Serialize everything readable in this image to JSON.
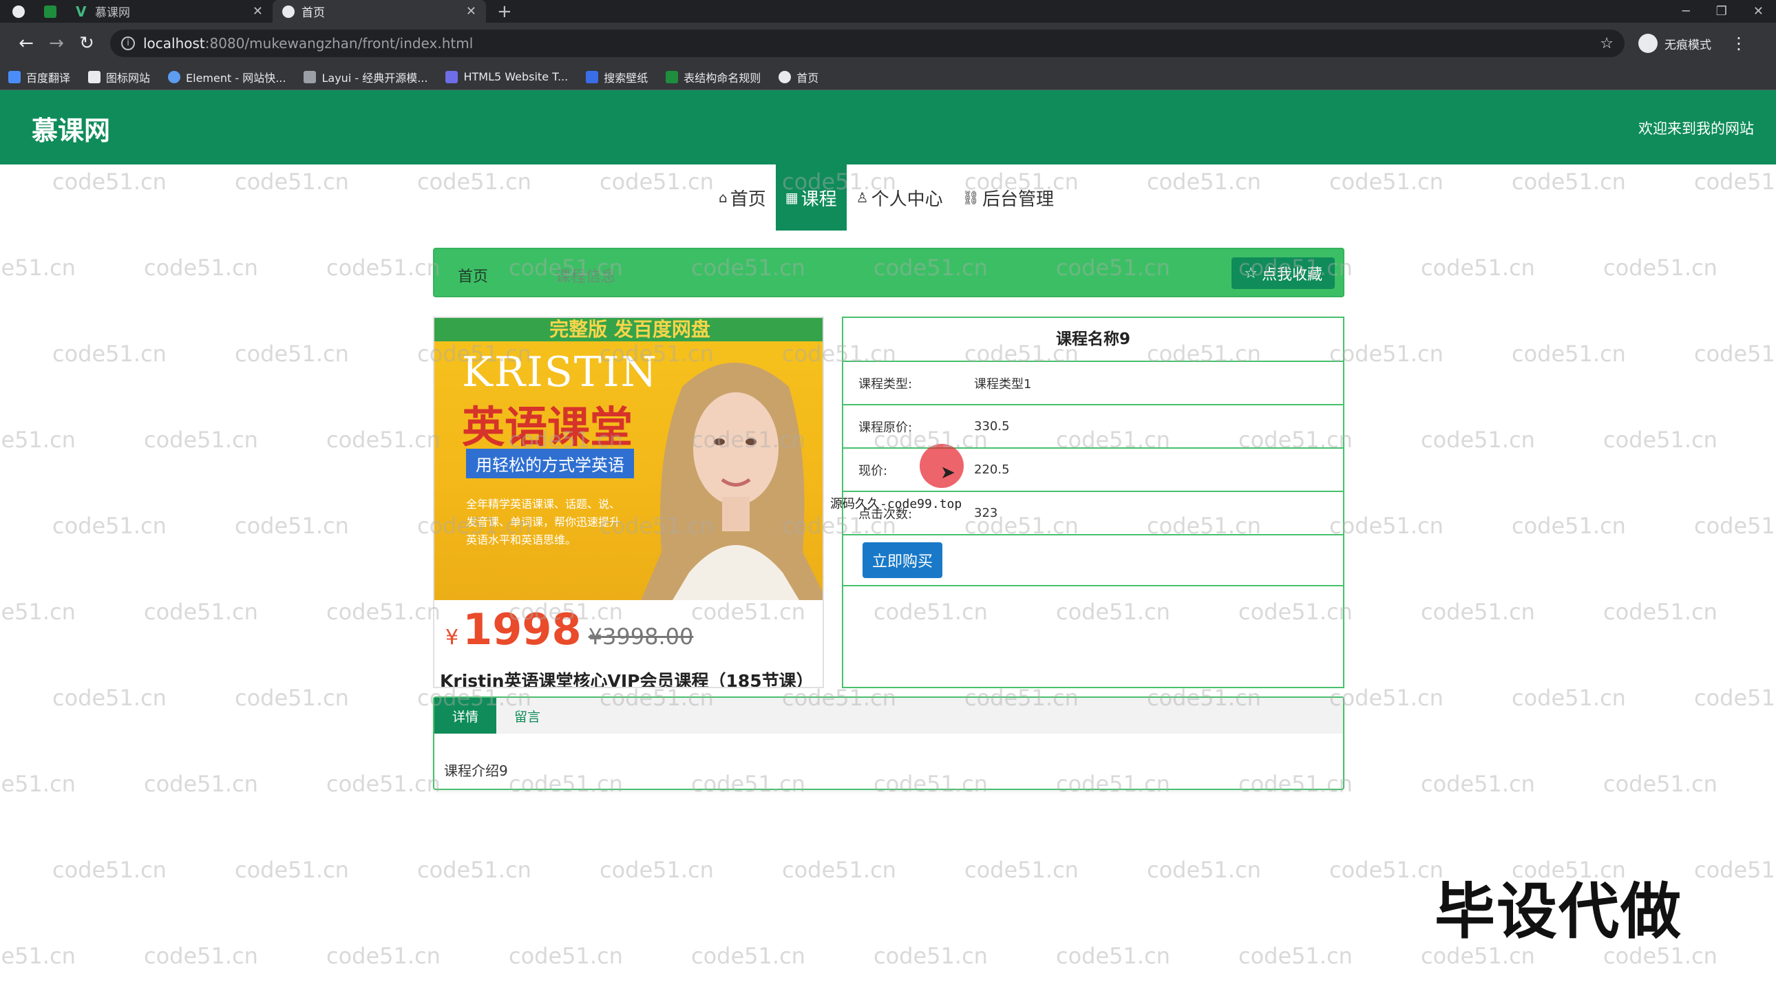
{
  "browser": {
    "tabs": [
      {
        "title": "慕课网",
        "active": false
      },
      {
        "title": "首页",
        "active": true
      }
    ],
    "new_tab_symbol": "+",
    "url_host": "localhost",
    "url_rest": ":8080/mukewangzhan/front/index.html",
    "incognito_label": "无痕模式",
    "bookmarks": [
      "百度翻译",
      "图标网站",
      "Element - 网站快...",
      "Layui - 经典开源模...",
      "HTML5 Website T...",
      "搜索壁纸",
      "表结构命名规则",
      "首页"
    ]
  },
  "site": {
    "logo": "慕课网",
    "welcome": "欢迎来到我的网站",
    "nav": [
      {
        "label": "首页",
        "icon": "home-icon",
        "glyph": "⌂"
      },
      {
        "label": "课程",
        "icon": "grid-icon",
        "glyph": "▦"
      },
      {
        "label": "个人中心",
        "icon": "user-icon",
        "glyph": "♙"
      },
      {
        "label": "后台管理",
        "icon": "link-icon",
        "glyph": "⛓"
      }
    ],
    "active_nav": "课程"
  },
  "breadcrumb": {
    "home": "首页",
    "current": "课程信息",
    "favorite_label": "点我收藏",
    "favorite_icon": "star-icon"
  },
  "course_image": {
    "banner": "完整版 发百度网盘",
    "brand": "KRISTIN",
    "title": "英语课堂",
    "slogan": "用轻松的方式学英语",
    "desc": "全年精学英语课课、话题、说、发音课、单词课，帮你迅速提升英语水平和英语思维。",
    "currency": "¥",
    "price": "1998",
    "old_price": "¥3998.00",
    "caption": "Kristin英语课堂核心VIP会员课程（185节课）"
  },
  "course": {
    "name": "课程名称9",
    "rows": [
      {
        "label": "课程类型:",
        "value": "课程类型1"
      },
      {
        "label": "课程原价:",
        "value": "330.5"
      },
      {
        "label": "现价:",
        "value": "220.5"
      },
      {
        "label": "点击次数:",
        "value": "323"
      }
    ],
    "buy_label": "立即购买"
  },
  "overlay_note": "源码久久-code99.top",
  "detail_tabs": {
    "tabs": [
      "详情",
      "留言"
    ],
    "active": "详情",
    "content": "课程介绍9"
  },
  "promo_text": "毕设代做",
  "watermark_text": "code51.cn",
  "colors": {
    "brand_green": "#0f8c5a",
    "crumb_green": "#3cbf64",
    "buy_blue": "#1979c8",
    "price_red": "#e94b2b"
  }
}
